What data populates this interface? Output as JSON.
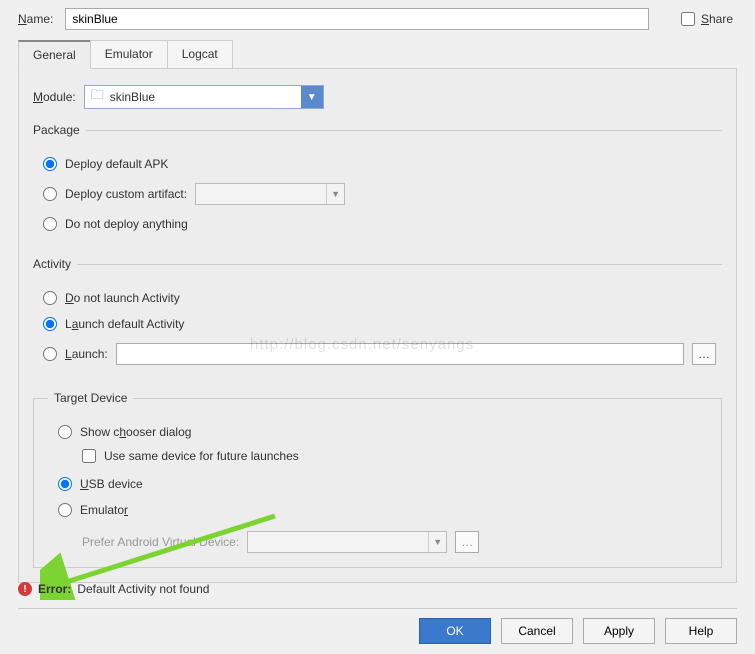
{
  "top": {
    "name_label": "Name:",
    "name_value": "skinBlue",
    "share_label": "Share"
  },
  "tabs": {
    "t0": "General",
    "t1": "Emulator",
    "t2": "Logcat"
  },
  "module": {
    "label": "Module:",
    "value": "skinBlue"
  },
  "package": {
    "legend": "Package",
    "r0": "Deploy default APK",
    "r1": "Deploy custom artifact:",
    "r2": "Do not deploy anything"
  },
  "activity": {
    "legend": "Activity",
    "r0": "Do not launch Activity",
    "r1": "Launch default Activity",
    "r2": "Launch:",
    "launch_value": ""
  },
  "target": {
    "legend": "Target Device",
    "r0": "Show chooser dialog",
    "c0": "Use same device for future launches",
    "r1": "USB device",
    "r2": "Emulator",
    "prefer_label": "Prefer Android Virtual Device:",
    "prefer_value": ""
  },
  "error": {
    "label": "Error:",
    "message": "Default Activity not found"
  },
  "watermark": "http://blog.csdn.net/senyangs",
  "footer": {
    "ok": "OK",
    "cancel": "Cancel",
    "apply": "Apply",
    "help": "Help"
  },
  "colors": {
    "accent": "#3b79cc",
    "error": "#d23b3b"
  }
}
